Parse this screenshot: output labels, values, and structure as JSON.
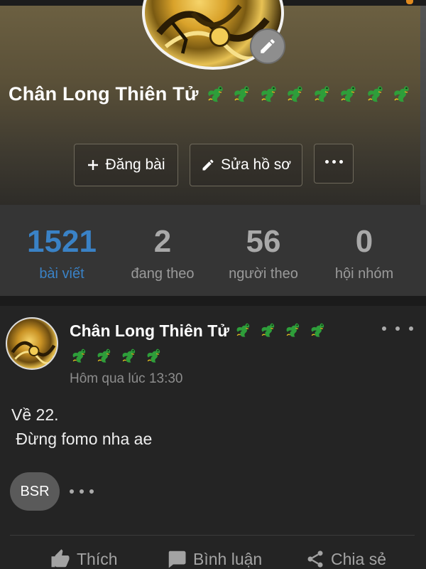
{
  "profile": {
    "name": "Chân Long Thiên Tử",
    "name_emoji_count": 8
  },
  "actions": {
    "post_label": "Đăng bài",
    "edit_label": "Sửa hồ sơ"
  },
  "stats": [
    {
      "value": "1521",
      "label": "bài viết",
      "active": true
    },
    {
      "value": "2",
      "label": "đang theo",
      "active": false
    },
    {
      "value": "56",
      "label": "người theo",
      "active": false
    },
    {
      "value": "0",
      "label": "hội nhóm",
      "active": false
    }
  ],
  "post": {
    "author": "Chân Long Thiên Tử",
    "time": "Hôm qua lúc 13:30",
    "body": "Về 22.\n Đừng fomo nha ae",
    "badge": "BSR"
  },
  "reactions": {
    "like": "Thích",
    "comment": "Bình luận",
    "share": "Chia sẻ"
  },
  "colors": {
    "accent": "#3a82c6",
    "background": "#1f1f1f",
    "dragon": "#2e9e3a"
  },
  "icons": [
    "pencil-icon",
    "plus-icon",
    "more-icon",
    "dragon-emoji",
    "like-icon",
    "comment-icon",
    "share-icon"
  ]
}
